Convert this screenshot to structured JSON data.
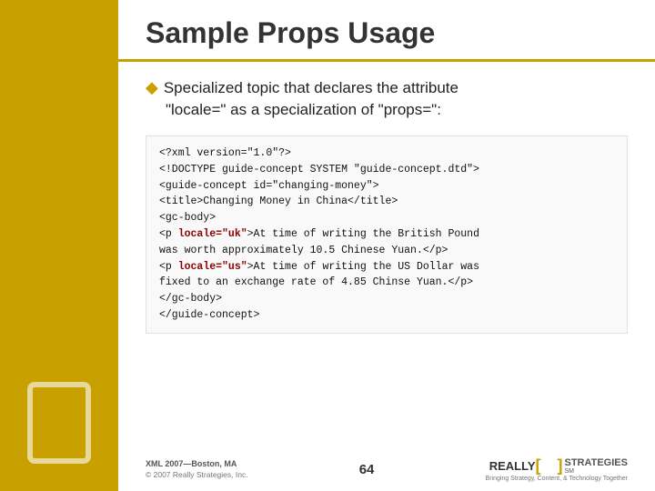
{
  "sidebar": {
    "background_color": "#c8a000"
  },
  "header": {
    "title": "Sample Props Usage",
    "underline_color": "#c8a000"
  },
  "bullet": {
    "diamond": "◆",
    "text_line1": "Specialized topic that declares the attribute",
    "text_line2": "\"locale=\" as a specialization of \"props=\":"
  },
  "code": {
    "line1": "<?xml version=\"1.0\"?>",
    "line2": "<!DOCTYPE guide-concept SYSTEM \"guide-concept.dtd\">",
    "line3": "<guide-concept id=\"changing-money\">",
    "line4": "  <title>Changing Money in China</title>",
    "line5": "  <gc-body>",
    "line6_pre": "    <p ",
    "line6_locale": "locale=\"uk\"",
    "line6_post": ">At time of writing the British Pound",
    "line7": "was worth approximately 10.5 Chinese Yuan.</p>",
    "line8_pre": "    <p ",
    "line8_locale": "locale=\"us\"",
    "line8_post": ">At time of writing the US Dollar was",
    "line9": "fixed to an exchange rate of 4.85 Chinse Yuan.</p>",
    "line10": "  </gc-body>",
    "line11": "</guide-concept>"
  },
  "footer": {
    "conference": "XML 2007—Boston, MA",
    "copyright": "© 2007 Really Strategies, Inc.",
    "page_number": "64",
    "logo_really": "REALLY",
    "logo_bracket_open": "[",
    "logo_bracket_close": "]",
    "logo_strategies": "STRATEGIES",
    "logo_sup": "SM",
    "logo_tagline": "Bringing Strategy, Content, & Technology Together"
  }
}
